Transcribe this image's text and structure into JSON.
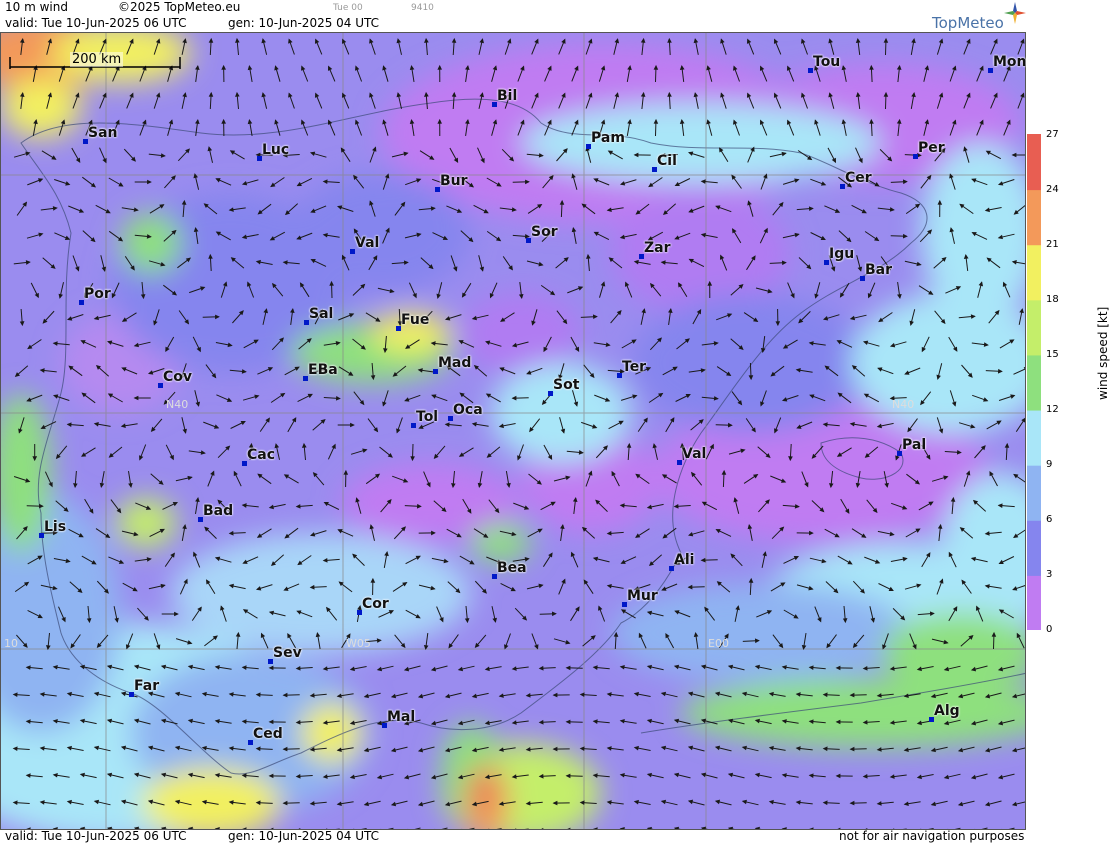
{
  "header": {
    "product": "10 m wind",
    "copyright": "©2025 TopMeteo.eu",
    "run_label": "Tue 00",
    "run_code": "9410",
    "valid": "valid:  Tue  10-Jun-2025  06 UTC",
    "gen": "gen: 10-Jun-2025 04 UTC",
    "logo": "TopMeteo"
  },
  "footer": {
    "valid": "valid:  Tue  10-Jun-2025  06 UTC",
    "gen": "gen: 10-Jun-2025 04 UTC",
    "notice": "not for air navigation purposes"
  },
  "scale_bar": {
    "label": "200 km"
  },
  "grid_labels": {
    "lat_left": "N40",
    "lat_right": "N40",
    "lon_w10": "10",
    "lon_w05": "W05",
    "lon_e00": "E00"
  },
  "cities": [
    {
      "name": "San"
    },
    {
      "name": "Luc"
    },
    {
      "name": "Bil"
    },
    {
      "name": "Pam"
    },
    {
      "name": "Cil"
    },
    {
      "name": "Tou"
    },
    {
      "name": "Mon"
    },
    {
      "name": "Per"
    },
    {
      "name": "Cer"
    },
    {
      "name": "Bur"
    },
    {
      "name": "Sor"
    },
    {
      "name": "Zar"
    },
    {
      "name": "Igu"
    },
    {
      "name": "Bar"
    },
    {
      "name": "Val"
    },
    {
      "name": "Por"
    },
    {
      "name": "Sal"
    },
    {
      "name": "Fue"
    },
    {
      "name": "Cov"
    },
    {
      "name": "EBa"
    },
    {
      "name": "Mad"
    },
    {
      "name": "Ter"
    },
    {
      "name": "Sot"
    },
    {
      "name": "Tol"
    },
    {
      "name": "Oca"
    },
    {
      "name": "Cac"
    },
    {
      "name": "Val"
    },
    {
      "name": "Pal"
    },
    {
      "name": "Bad"
    },
    {
      "name": "Lis"
    },
    {
      "name": "Ali"
    },
    {
      "name": "Bea"
    },
    {
      "name": "Mur"
    },
    {
      "name": "Cor"
    },
    {
      "name": "Sev"
    },
    {
      "name": "Far"
    },
    {
      "name": "Mal"
    },
    {
      "name": "Alg"
    },
    {
      "name": "Ced"
    }
  ],
  "legend": {
    "title": "wind speed  [kt]",
    "unit": "kt",
    "ticks": [
      "27",
      "24",
      "21",
      "18",
      "15",
      "12",
      "9",
      "6",
      "3",
      "0"
    ],
    "colors": [
      "#c07cf2",
      "#a07cf0",
      "#8585ee",
      "#8fb4f2",
      "#a9e6f8",
      "#b2f0f6",
      "#8ee07e",
      "#6ed96a",
      "#c4ee6a",
      "#f2f060",
      "#f7c860",
      "#f3995a",
      "#e85e52"
    ]
  }
}
